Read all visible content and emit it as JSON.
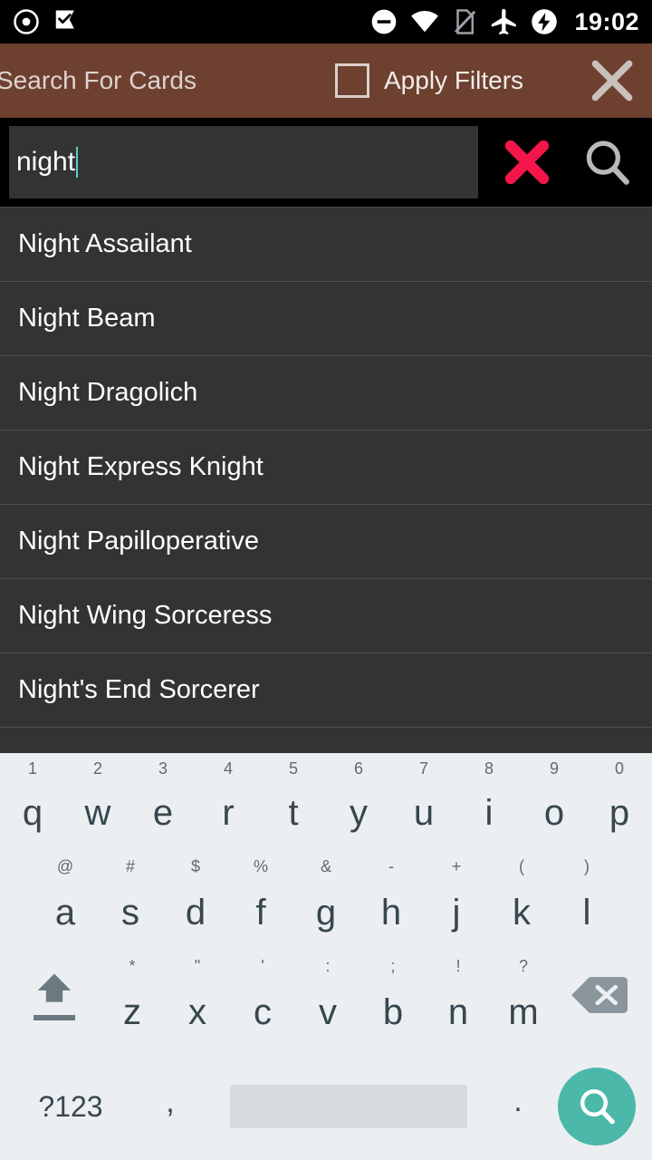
{
  "status_bar": {
    "time": "19:02",
    "icons_left": [
      "record-circle-icon",
      "checkmark-flag-icon"
    ],
    "icons_right": [
      "do-not-disturb-icon",
      "wifi-icon",
      "no-sim-icon",
      "airplane-mode-icon",
      "battery-charging-icon"
    ]
  },
  "app_bar": {
    "title": "Search For Cards",
    "filter_label": "Apply Filters",
    "filter_checked": false,
    "close_label": "close-icon"
  },
  "search": {
    "value": "night",
    "placeholder": "",
    "clear_label": "clear-icon",
    "submit_label": "search-icon"
  },
  "suggestions": [
    {
      "label": "Night Assailant"
    },
    {
      "label": "Night Beam"
    },
    {
      "label": "Night Dragolich"
    },
    {
      "label": "Night Express Knight"
    },
    {
      "label": "Night Papilloperative"
    },
    {
      "label": "Night Wing Sorceress"
    },
    {
      "label": "Night's End Sorcerer"
    },
    {
      "label": ""
    }
  ],
  "keyboard": {
    "row1": [
      {
        "key": "q",
        "alt": "1"
      },
      {
        "key": "w",
        "alt": "2"
      },
      {
        "key": "e",
        "alt": "3"
      },
      {
        "key": "r",
        "alt": "4"
      },
      {
        "key": "t",
        "alt": "5"
      },
      {
        "key": "y",
        "alt": "6"
      },
      {
        "key": "u",
        "alt": "7"
      },
      {
        "key": "i",
        "alt": "8"
      },
      {
        "key": "o",
        "alt": "9"
      },
      {
        "key": "p",
        "alt": "0"
      }
    ],
    "row2": [
      {
        "key": "a",
        "alt": "@"
      },
      {
        "key": "s",
        "alt": "#"
      },
      {
        "key": "d",
        "alt": "$"
      },
      {
        "key": "f",
        "alt": "%"
      },
      {
        "key": "g",
        "alt": "&"
      },
      {
        "key": "h",
        "alt": "-"
      },
      {
        "key": "j",
        "alt": "+"
      },
      {
        "key": "k",
        "alt": "("
      },
      {
        "key": "l",
        "alt": ")"
      }
    ],
    "row3": [
      {
        "key": "z",
        "alt": "*"
      },
      {
        "key": "x",
        "alt": "\""
      },
      {
        "key": "c",
        "alt": "'"
      },
      {
        "key": "v",
        "alt": ":"
      },
      {
        "key": "b",
        "alt": ";"
      },
      {
        "key": "n",
        "alt": "!"
      },
      {
        "key": "m",
        "alt": "?"
      }
    ],
    "shift_label": "shift-icon",
    "backspace_label": "backspace-icon",
    "symbols_label": "?123",
    "comma_label": ",",
    "space_label": "",
    "period_label": ".",
    "go_label": "search-icon"
  },
  "colors": {
    "app_bar": "#6d4030",
    "list_bg": "#333333",
    "accent_go": "#4bb8a9",
    "clear_red": "#f4154b",
    "caret": "#5ecfc4"
  }
}
